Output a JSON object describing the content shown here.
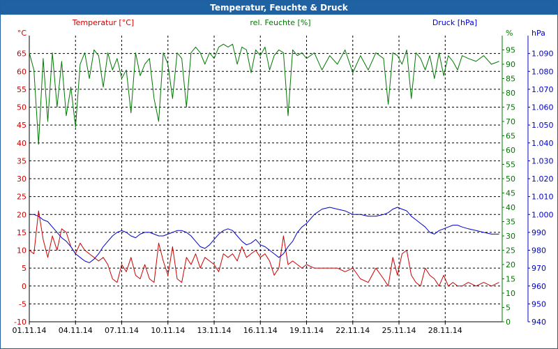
{
  "title": "Temperatur, Feuchte & Druck",
  "colors": {
    "temperature": "#cc0000",
    "humidity": "#007700",
    "pressure": "#0000cc",
    "grid": "#000000",
    "titlebar": "#1f62a3"
  },
  "chart_data": {
    "type": "line",
    "title": "Temperatur, Feuchte & Druck",
    "x_tick_labels": [
      "01.11.14",
      "04.11.14",
      "07.11.14",
      "10.11.14",
      "13.11.14",
      "16.11.14",
      "19.11.14",
      "22.11.14",
      "25.11.14",
      "28.11.14"
    ],
    "x_range_days": [
      0,
      30.7
    ],
    "grid": true,
    "axes": {
      "temperature": {
        "label": "Temperatur [°C]",
        "unit": "°C",
        "range": [
          -10,
          70
        ],
        "ticks": [
          -10,
          -5,
          0,
          5,
          10,
          15,
          20,
          25,
          30,
          35,
          40,
          45,
          50,
          55,
          60,
          65
        ]
      },
      "humidity": {
        "label": "rel. Feuchte [%]",
        "unit": "%",
        "range": [
          0,
          100
        ],
        "ticks": [
          0,
          5,
          10,
          15,
          20,
          25,
          30,
          35,
          40,
          45,
          50,
          55,
          60,
          65,
          70,
          75,
          80,
          85,
          90,
          95
        ]
      },
      "pressure": {
        "label": "Druck [hPa]",
        "unit": "hPa",
        "range": [
          940,
          1100
        ],
        "ticks": [
          "940",
          "950",
          "960",
          "970",
          "980",
          "990",
          "1.000",
          "1.010",
          "1.020",
          "1.030",
          "1.040",
          "1.050",
          "1.060",
          "1.070",
          "1.080",
          "1.090"
        ]
      }
    },
    "series": [
      {
        "name": "Temperatur [°C]",
        "axis": "temperature",
        "x": [
          0,
          0.3,
          0.6,
          0.9,
          1.2,
          1.5,
          1.8,
          2.1,
          2.4,
          2.7,
          3.0,
          3.3,
          3.6,
          3.9,
          4.2,
          4.5,
          4.8,
          5.1,
          5.4,
          5.7,
          6.0,
          6.3,
          6.6,
          6.9,
          7.2,
          7.5,
          7.8,
          8.1,
          8.4,
          8.7,
          9.0,
          9.3,
          9.6,
          9.9,
          10.2,
          10.5,
          10.8,
          11.1,
          11.4,
          11.7,
          12.0,
          12.3,
          12.6,
          12.9,
          13.2,
          13.5,
          13.8,
          14.1,
          14.4,
          14.7,
          15.0,
          15.3,
          15.6,
          15.9,
          16.2,
          16.5,
          16.8,
          17.1,
          17.4,
          17.7,
          18.0,
          18.5,
          19.0,
          19.5,
          20.0,
          20.5,
          21.0,
          21.5,
          22.0,
          22.5,
          23.0,
          23.3,
          23.6,
          23.9,
          24.2,
          24.5,
          24.8,
          25.1,
          25.4,
          25.7,
          26.0,
          26.3,
          26.6,
          26.9,
          27.2,
          27.5,
          27.8,
          28.1,
          28.5,
          29.0,
          29.5,
          30.0,
          30.5
        ],
        "values": [
          10,
          9,
          21,
          13,
          8,
          14,
          10,
          16,
          15,
          11,
          9,
          12,
          10,
          9,
          8,
          7,
          8,
          6,
          2,
          1,
          6,
          4,
          8,
          3,
          2,
          6,
          2,
          1,
          12,
          7,
          3,
          11,
          2,
          1,
          8,
          6,
          9,
          5,
          8,
          7,
          6,
          4,
          9,
          8,
          9,
          7,
          11,
          8,
          9,
          10,
          8,
          9,
          7,
          3,
          5,
          14,
          6,
          7,
          6,
          5,
          6,
          5,
          5,
          5,
          5,
          4,
          5,
          2,
          1,
          5,
          2,
          0,
          8,
          3,
          9,
          10,
          3,
          1,
          0,
          5,
          3,
          2,
          0,
          3,
          0,
          1,
          0,
          0,
          1,
          0,
          1,
          0,
          1
        ]
      },
      {
        "name": "rel. Feuchte [%]",
        "axis": "humidity",
        "x": [
          0,
          0.3,
          0.6,
          0.9,
          1.2,
          1.5,
          1.8,
          2.1,
          2.4,
          2.7,
          3.0,
          3.3,
          3.6,
          3.9,
          4.2,
          4.5,
          4.8,
          5.1,
          5.4,
          5.7,
          6.0,
          6.3,
          6.6,
          6.9,
          7.2,
          7.5,
          7.8,
          8.1,
          8.4,
          8.7,
          9.0,
          9.3,
          9.6,
          9.9,
          10.2,
          10.5,
          10.8,
          11.1,
          11.4,
          11.7,
          12.0,
          12.3,
          12.6,
          12.9,
          13.2,
          13.5,
          13.8,
          14.1,
          14.4,
          14.7,
          15.0,
          15.3,
          15.6,
          15.9,
          16.2,
          16.5,
          16.8,
          17.1,
          17.4,
          17.7,
          18.0,
          18.5,
          19.0,
          19.5,
          20.0,
          20.5,
          21.0,
          21.5,
          22.0,
          22.5,
          23.0,
          23.3,
          23.6,
          23.9,
          24.2,
          24.5,
          24.8,
          25.1,
          25.4,
          25.7,
          26.0,
          26.3,
          26.6,
          26.9,
          27.2,
          27.5,
          27.8,
          28.1,
          28.5,
          29.0,
          29.5,
          30.0,
          30.5
        ],
        "values": [
          94,
          88,
          62,
          92,
          70,
          94,
          75,
          91,
          72,
          82,
          68,
          90,
          94,
          85,
          95,
          93,
          82,
          94,
          88,
          92,
          85,
          88,
          73,
          94,
          86,
          90,
          92,
          78,
          70,
          94,
          90,
          78,
          94,
          92,
          75,
          94,
          96,
          94,
          90,
          94,
          92,
          96,
          97,
          96,
          97,
          90,
          96,
          95,
          87,
          95,
          93,
          96,
          88,
          93,
          95,
          94,
          72,
          95,
          93,
          94,
          92,
          94,
          88,
          93,
          90,
          95,
          87,
          93,
          88,
          94,
          92,
          76,
          94,
          93,
          90,
          95,
          78,
          94,
          92,
          88,
          93,
          85,
          94,
          86,
          93,
          91,
          88,
          93,
          92,
          91,
          93,
          90,
          91
        ]
      },
      {
        "name": "Druck [hPa]",
        "axis": "pressure",
        "x": [
          0,
          0.3,
          0.6,
          0.9,
          1.2,
          1.5,
          1.8,
          2.1,
          2.4,
          2.7,
          3.0,
          3.3,
          3.6,
          3.9,
          4.2,
          4.5,
          4.8,
          5.1,
          5.4,
          5.7,
          6.0,
          6.3,
          6.6,
          6.9,
          7.2,
          7.5,
          7.8,
          8.1,
          8.4,
          8.7,
          9.0,
          9.3,
          9.6,
          9.9,
          10.2,
          10.5,
          10.8,
          11.1,
          11.4,
          11.7,
          12.0,
          12.3,
          12.6,
          12.9,
          13.2,
          13.5,
          13.8,
          14.1,
          14.4,
          14.7,
          15.0,
          15.3,
          15.6,
          15.9,
          16.2,
          16.5,
          16.8,
          17.1,
          17.4,
          17.7,
          18.0,
          18.5,
          19.0,
          19.5,
          20.0,
          20.5,
          21.0,
          21.5,
          22.0,
          22.5,
          23.0,
          23.3,
          23.6,
          23.9,
          24.2,
          24.5,
          24.8,
          25.1,
          25.4,
          25.7,
          26.0,
          26.3,
          26.6,
          26.9,
          27.2,
          27.5,
          27.8,
          28.1,
          28.5,
          29.0,
          29.5,
          30.0,
          30.5
        ],
        "values": [
          1000,
          1000,
          999,
          997,
          996,
          993,
          990,
          987,
          985,
          982,
          978,
          976,
          974,
          973,
          975,
          978,
          982,
          985,
          988,
          990,
          991,
          990,
          988,
          987,
          989,
          990,
          990,
          989,
          988,
          988,
          989,
          990,
          991,
          991,
          990,
          988,
          985,
          982,
          981,
          983,
          986,
          989,
          991,
          992,
          991,
          988,
          985,
          983,
          984,
          986,
          983,
          982,
          980,
          978,
          976,
          978,
          982,
          985,
          990,
          993,
          995,
          1000,
          1003,
          1004,
          1003,
          1002,
          1000,
          1000,
          999,
          999,
          1000,
          1001,
          1003,
          1004,
          1003,
          1002,
          999,
          997,
          995,
          993,
          990,
          989,
          991,
          992,
          993,
          994,
          994,
          993,
          992,
          991,
          990,
          989,
          989
        ]
      }
    ]
  }
}
